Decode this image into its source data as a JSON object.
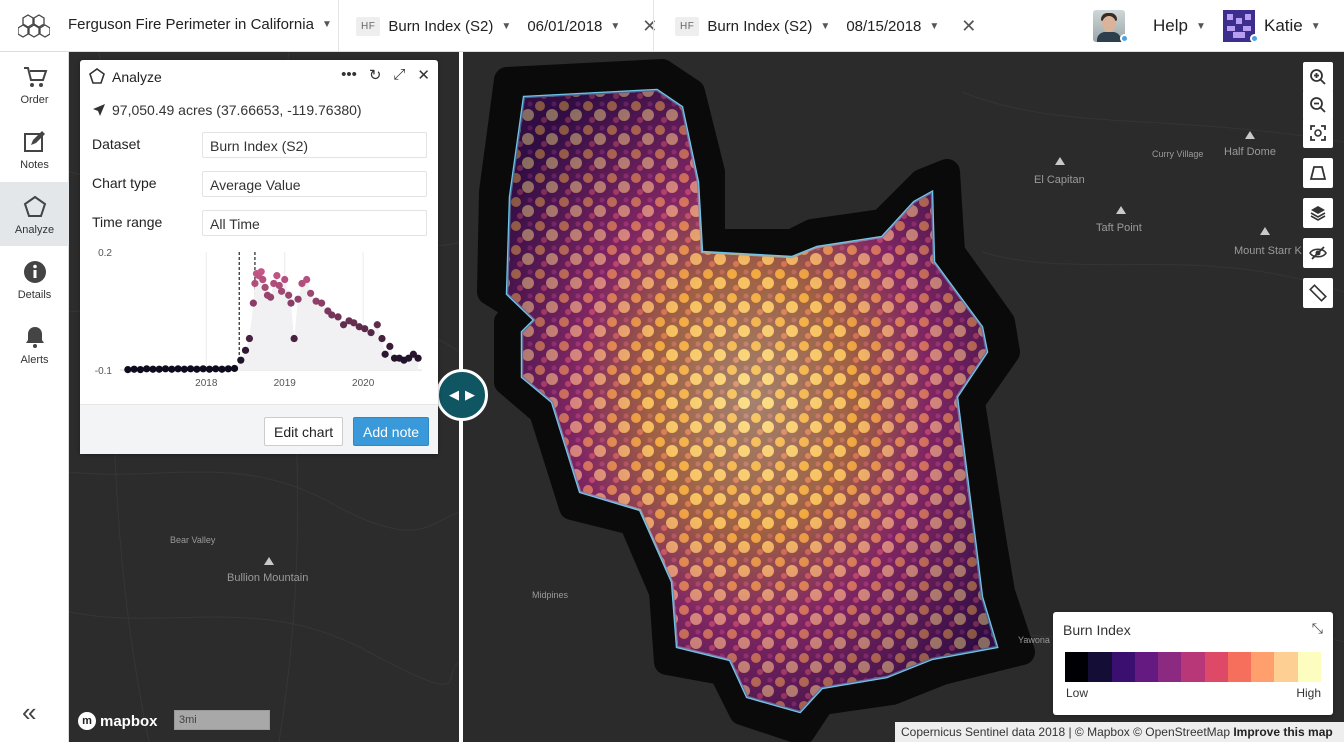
{
  "header": {
    "project_title": "Ferguson Fire Perimeter in California",
    "layers": [
      {
        "badge": "HF",
        "name": "Burn Index (S2)",
        "date": "06/01/2018"
      },
      {
        "badge": "HF",
        "name": "Burn Index (S2)",
        "date": "08/15/2018"
      }
    ],
    "help_label": "Help",
    "user_name": "Katie"
  },
  "sidebar": {
    "items": [
      {
        "label": "Order",
        "icon": "cart-icon"
      },
      {
        "label": "Notes",
        "icon": "note-icon"
      },
      {
        "label": "Analyze",
        "icon": "pentagon-icon",
        "active": true
      },
      {
        "label": "Details",
        "icon": "info-icon"
      },
      {
        "label": "Alerts",
        "icon": "bell-icon"
      }
    ],
    "collapse_glyph": "«"
  },
  "analyze_panel": {
    "title": "Analyze",
    "location": "97,050.49 acres (37.66653, -119.76380)",
    "fields": [
      {
        "label": "Dataset",
        "value": "Burn Index (S2)"
      },
      {
        "label": "Chart type",
        "value": "Average Value"
      },
      {
        "label": "Time range",
        "value": "All Time"
      }
    ],
    "edit_chart_label": "Edit chart",
    "add_note_label": "Add note"
  },
  "chart_data": {
    "type": "scatter",
    "title": "",
    "xlabel": "",
    "ylabel": "",
    "ylim": [
      -0.1,
      0.2
    ],
    "y_ticks": [
      "0.2",
      "-0.1"
    ],
    "x_ticks": [
      "2018",
      "2019",
      "2020"
    ],
    "x_tick_values": [
      2018,
      2019,
      2020
    ],
    "xlim": [
      2016.9,
      2020.75
    ],
    "markers": [
      2018.42,
      2018.62
    ],
    "series": [
      {
        "values": [
          [
            2017.0,
            -0.099
          ],
          [
            2017.08,
            -0.098
          ],
          [
            2017.16,
            -0.099
          ],
          [
            2017.24,
            -0.097
          ],
          [
            2017.32,
            -0.098
          ],
          [
            2017.4,
            -0.098
          ],
          [
            2017.48,
            -0.097
          ],
          [
            2017.56,
            -0.098
          ],
          [
            2017.64,
            -0.097
          ],
          [
            2017.72,
            -0.098
          ],
          [
            2017.8,
            -0.097
          ],
          [
            2017.88,
            -0.098
          ],
          [
            2017.96,
            -0.097
          ],
          [
            2018.04,
            -0.098
          ],
          [
            2018.12,
            -0.097
          ],
          [
            2018.2,
            -0.098
          ],
          [
            2018.28,
            -0.097
          ],
          [
            2018.36,
            -0.096
          ],
          [
            2018.44,
            -0.075
          ],
          [
            2018.5,
            -0.05
          ],
          [
            2018.55,
            -0.02
          ],
          [
            2018.6,
            0.07
          ],
          [
            2018.62,
            0.12
          ],
          [
            2018.64,
            0.145
          ],
          [
            2018.67,
            0.14
          ],
          [
            2018.7,
            0.15
          ],
          [
            2018.72,
            0.13
          ],
          [
            2018.75,
            0.11
          ],
          [
            2018.78,
            0.09
          ],
          [
            2018.82,
            0.085
          ],
          [
            2018.86,
            0.12
          ],
          [
            2018.9,
            0.14
          ],
          [
            2018.93,
            0.115
          ],
          [
            2018.96,
            0.1
          ],
          [
            2019.0,
            0.13
          ],
          [
            2019.05,
            0.09
          ],
          [
            2019.08,
            0.07
          ],
          [
            2019.12,
            -0.02
          ],
          [
            2019.17,
            0.08
          ],
          [
            2019.22,
            0.12
          ],
          [
            2019.28,
            0.13
          ],
          [
            2019.33,
            0.095
          ],
          [
            2019.4,
            0.075
          ],
          [
            2019.47,
            0.07
          ],
          [
            2019.55,
            0.05
          ],
          [
            2019.6,
            0.04
          ],
          [
            2019.68,
            0.035
          ],
          [
            2019.75,
            0.015
          ],
          [
            2019.82,
            0.025
          ],
          [
            2019.88,
            0.02
          ],
          [
            2019.95,
            0.01
          ],
          [
            2020.02,
            0.005
          ],
          [
            2020.1,
            -0.005
          ],
          [
            2020.18,
            0.015
          ],
          [
            2020.24,
            -0.02
          ],
          [
            2020.28,
            -0.06
          ],
          [
            2020.34,
            -0.04
          ],
          [
            2020.4,
            -0.07
          ],
          [
            2020.46,
            -0.07
          ],
          [
            2020.52,
            -0.075
          ],
          [
            2020.58,
            -0.07
          ],
          [
            2020.64,
            -0.06
          ],
          [
            2020.7,
            -0.07
          ]
        ]
      }
    ],
    "grid": true,
    "color_low": "#0d0a1e",
    "color_high": "#cc5a8c"
  },
  "map": {
    "labels_left": [
      {
        "text": "Bear Valley",
        "size": "sm"
      },
      {
        "text": "Bullion Mountain",
        "size": "md"
      }
    ],
    "labels_right": [
      {
        "text": "Curry Village",
        "size": "sm"
      },
      {
        "text": "Half Dome",
        "size": "md"
      },
      {
        "text": "El Capitan",
        "size": "md"
      },
      {
        "text": "Taft Point",
        "size": "md"
      },
      {
        "text": "Mount Starr K",
        "size": "md"
      },
      {
        "text": "Midpines",
        "size": "sm"
      },
      {
        "text": "Yawona",
        "size": "sm"
      }
    ],
    "perimeter_color": "#6fc5e8",
    "tools": [
      "zoom-in-icon",
      "zoom-out-icon",
      "fit-bounds-icon",
      "shape-icon",
      "layers-icon",
      "visibility-off-icon",
      "ruler-icon"
    ]
  },
  "legend": {
    "title": "Burn Index",
    "low_label": "Low",
    "high_label": "High",
    "ramp": [
      "#000004",
      "#140e36",
      "#3b0f70",
      "#641a80",
      "#8c2981",
      "#b73779",
      "#de4968",
      "#f66e5c",
      "#fe9f6d",
      "#fecf92",
      "#fcfdbf"
    ]
  },
  "attribution": {
    "text": "Copernicus Sentinel data 2018 | © Mapbox © OpenStreetMap",
    "improve_label": "Improve this map",
    "brand": "mapbox",
    "scale_label": "3mi"
  }
}
